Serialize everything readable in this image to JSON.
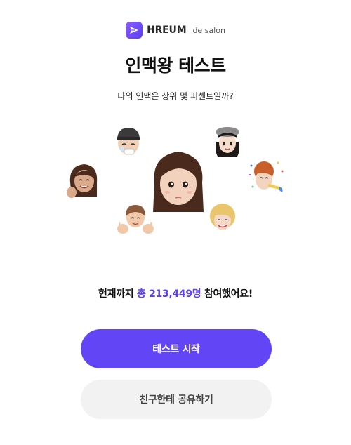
{
  "brand": {
    "name": "HREUM",
    "sub": "de salon",
    "icon": "paper-plane-icon",
    "color": "#6a46f6"
  },
  "title": "인맥왕 테스트",
  "subtitle": "나의 인맥은 상위 몇 퍼센트일까?",
  "stats": {
    "prefix": "현재까지",
    "count": "총 213,449명",
    "suffix": "참여했어요!",
    "accent_color": "#5b3ef5"
  },
  "buttons": {
    "start_label": "테스트 시작",
    "share_label": "친구한테 공유하기"
  },
  "avatars": [
    "girl-long-hair-avatar",
    "beanie-boy-avatar",
    "beret-girl-avatar",
    "woman-waving-avatar",
    "redhead-party-horn-avatar",
    "bowl-cut-boy-avatar",
    "blonde-woman-avatar"
  ]
}
